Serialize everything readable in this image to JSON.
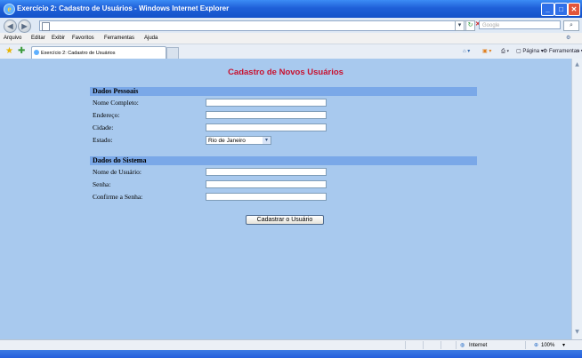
{
  "window": {
    "title": "Exercício 2: Cadastro de Usuários - Windows Internet Explorer"
  },
  "address_bar": {
    "search_placeholder": "Google"
  },
  "menu": [
    "Arquivo",
    "Editar",
    "Exibir",
    "Favoritos",
    "Ferramentas",
    "Ajuda"
  ],
  "tab": {
    "title": "Exercício 2: Cadastro de Usuários"
  },
  "command_bar": {
    "page_label": "Página",
    "tools_label": "Ferramentas"
  },
  "page": {
    "heading": "Cadastro de Novos Usuários",
    "sections": [
      {
        "title": "Dados Pessoais",
        "fields": [
          "Nome Completo:",
          "Endereço:",
          "Cidade:",
          "Estado:"
        ]
      },
      {
        "title": "Dados do Sistema",
        "fields": [
          "Nome de Usuário:",
          "Senha:",
          "Confirme a Senha:"
        ]
      }
    ],
    "estado_selected": "Rio de Janeiro",
    "submit_label": "Cadastrar o Usuário"
  },
  "status_bar": {
    "zone": "Internet",
    "zoom": "100%"
  },
  "colors": {
    "page_background": "#a8c9ee",
    "section_header": "#7aa8e8",
    "heading": "#c8102e",
    "titlebar": "#1f60d8"
  }
}
